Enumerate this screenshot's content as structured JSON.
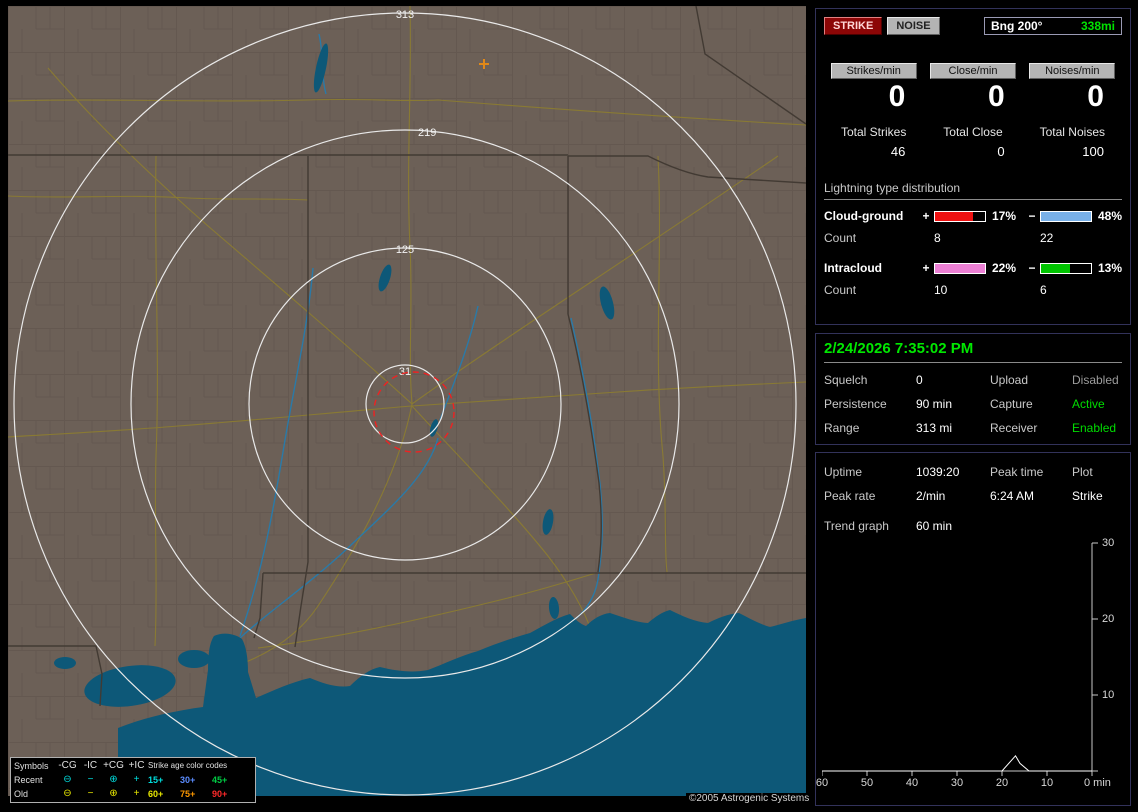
{
  "app": {
    "copyright": "©2005 Astrogenic Systems"
  },
  "colors": {
    "accent_green": "#00e000",
    "land": "#6c6057",
    "water": "#0d5878",
    "road": "#8d7d30",
    "range_ring": "#e9e9e9",
    "alarm_circle": "#ee2222",
    "panel_border": "#32325a"
  },
  "map": {
    "ring_labels": [
      "313",
      "219",
      "125",
      "31"
    ],
    "strike_marker": {
      "symbol": "+",
      "color": "#e08818"
    },
    "legend": {
      "title": "Symbols",
      "columns": [
        "-CG",
        "-IC",
        "+CG",
        "+IC"
      ],
      "symbols": [
        "⊖",
        "−",
        "⊕",
        "+"
      ],
      "age_title": "Strike age color codes",
      "rows": [
        {
          "label": "Recent",
          "symbol_color": "#00dede",
          "ages": [
            {
              "text": "15+",
              "color": "#00dede"
            },
            {
              "text": "30+",
              "color": "#5b8cff"
            },
            {
              "text": "45+",
              "color": "#00cc44"
            }
          ]
        },
        {
          "label": "Old",
          "symbol_color": "#e8e800",
          "ages": [
            {
              "text": "60+",
              "color": "#e8e800"
            },
            {
              "text": "75+",
              "color": "#ff9900"
            },
            {
              "text": "90+",
              "color": "#ff2a2a"
            }
          ]
        }
      ]
    }
  },
  "panel": {
    "mode_buttons": {
      "strike": "STRIKE",
      "noise": "NOISE"
    },
    "bearing": {
      "label": "Bng 200°",
      "value": "338mi",
      "value_color": "#00e000"
    },
    "rate_columns": [
      {
        "button": "Strikes/min",
        "rate": "0",
        "total_label": "Total Strikes",
        "total": "46"
      },
      {
        "button": "Close/min",
        "rate": "0",
        "total_label": "Total Close",
        "total": "0"
      },
      {
        "button": "Noises/min",
        "rate": "0",
        "total_label": "Total Noises",
        "total": "100"
      }
    ],
    "distribution": {
      "title": "Lightning type distribution",
      "count_label": "Count",
      "plus_sign": "+",
      "minus_sign": "−",
      "rows": [
        {
          "label": "Cloud-ground",
          "plus": {
            "value": 17,
            "pct": "17%",
            "count": "8",
            "color": "#ee1111"
          },
          "minus": {
            "value": 48,
            "pct": "48%",
            "count": "22",
            "color": "#78b0e8"
          }
        },
        {
          "label": "Intracloud",
          "plus": {
            "value": 22,
            "pct": "22%",
            "count": "10",
            "color": "#ec7fd4"
          },
          "minus": {
            "value": 13,
            "pct": "13%",
            "count": "6",
            "color": "#00c400"
          }
        }
      ]
    },
    "status": {
      "datetime": "2/24/2026 7:35:02 PM",
      "datetime_color": "#00e800",
      "rows": [
        {
          "key": "Squelch",
          "value": "0",
          "key2": "Upload",
          "value2": "Disabled",
          "value2_color": "#9c9c9c"
        },
        {
          "key": "Persistence",
          "value": "90 min",
          "key2": "Capture",
          "value2": "Active",
          "value2_color": "#00dd00"
        },
        {
          "key": "Range",
          "value": "313 mi",
          "key2": "Receiver",
          "value2": "Enabled",
          "value2_color": "#00dd00"
        }
      ]
    },
    "stats": {
      "uptime_label": "Uptime",
      "uptime_value": "1039:20",
      "peak_time_label": "Peak time",
      "peak_time_value": "6:24 AM",
      "plot_label": "Plot",
      "plot_value": "Strike",
      "peak_rate_label": "Peak rate",
      "peak_rate_value": "2/min",
      "trend_label": "Trend graph",
      "trend_value": "60 min"
    }
  },
  "chart_data": {
    "type": "line",
    "title": "Trend graph",
    "window": "60 min",
    "x_range": [
      60,
      0
    ],
    "xlabel": "min",
    "ylabel": "strikes/min",
    "ylim": [
      0,
      30
    ],
    "yticks": [
      "30",
      "20",
      "10"
    ],
    "xticks": [
      "60",
      "50",
      "40",
      "30",
      "20",
      "10",
      "0 min"
    ],
    "grid": false,
    "legend_position": "none",
    "series": [
      {
        "name": "Strike",
        "points": [
          [
            60,
            0
          ],
          [
            20,
            0
          ],
          [
            17,
            2
          ],
          [
            16,
            1
          ],
          [
            14,
            0
          ],
          [
            0,
            0
          ]
        ]
      }
    ]
  }
}
